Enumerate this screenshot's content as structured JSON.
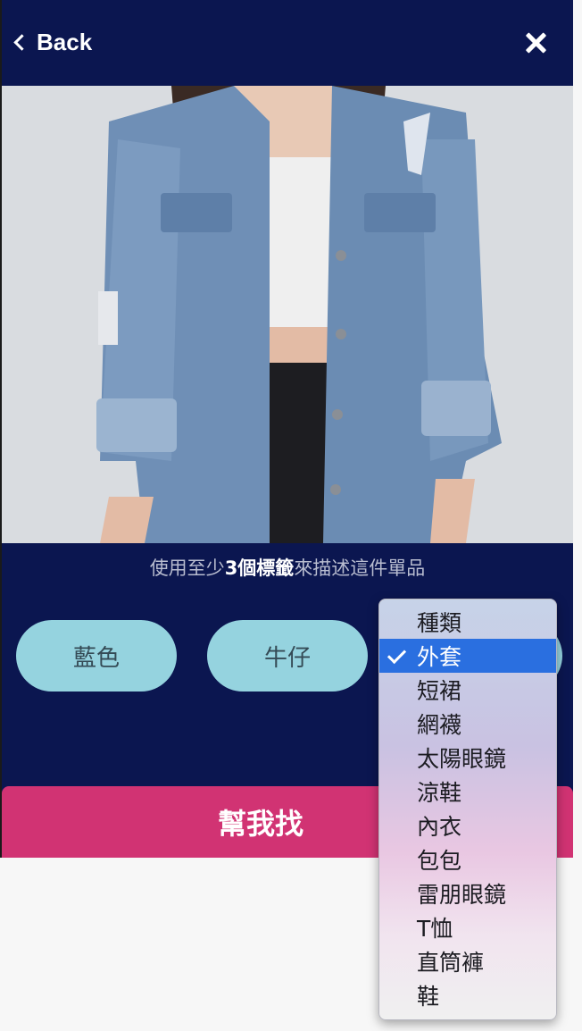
{
  "header": {
    "back_label": "Back"
  },
  "prompt": {
    "before": "使用至少",
    "highlight": "3個標籤",
    "after": "來描述這件單品"
  },
  "tags": [
    {
      "label": "藍色"
    },
    {
      "label": "牛仔"
    },
    {
      "label": "外套"
    }
  ],
  "find_button": {
    "label": "幫我找"
  },
  "category_select": {
    "selected": "外套",
    "options": [
      "種類",
      "外套",
      "短裙",
      "網襪",
      "太陽眼鏡",
      "涼鞋",
      "內衣",
      "包包",
      "雷朋眼鏡",
      "T恤",
      "直筒褲",
      "鞋"
    ]
  },
  "colors": {
    "background": "#0b1650",
    "tag": "#95d3df",
    "button": "#d13373",
    "selected_option": "#2a6fe0"
  }
}
